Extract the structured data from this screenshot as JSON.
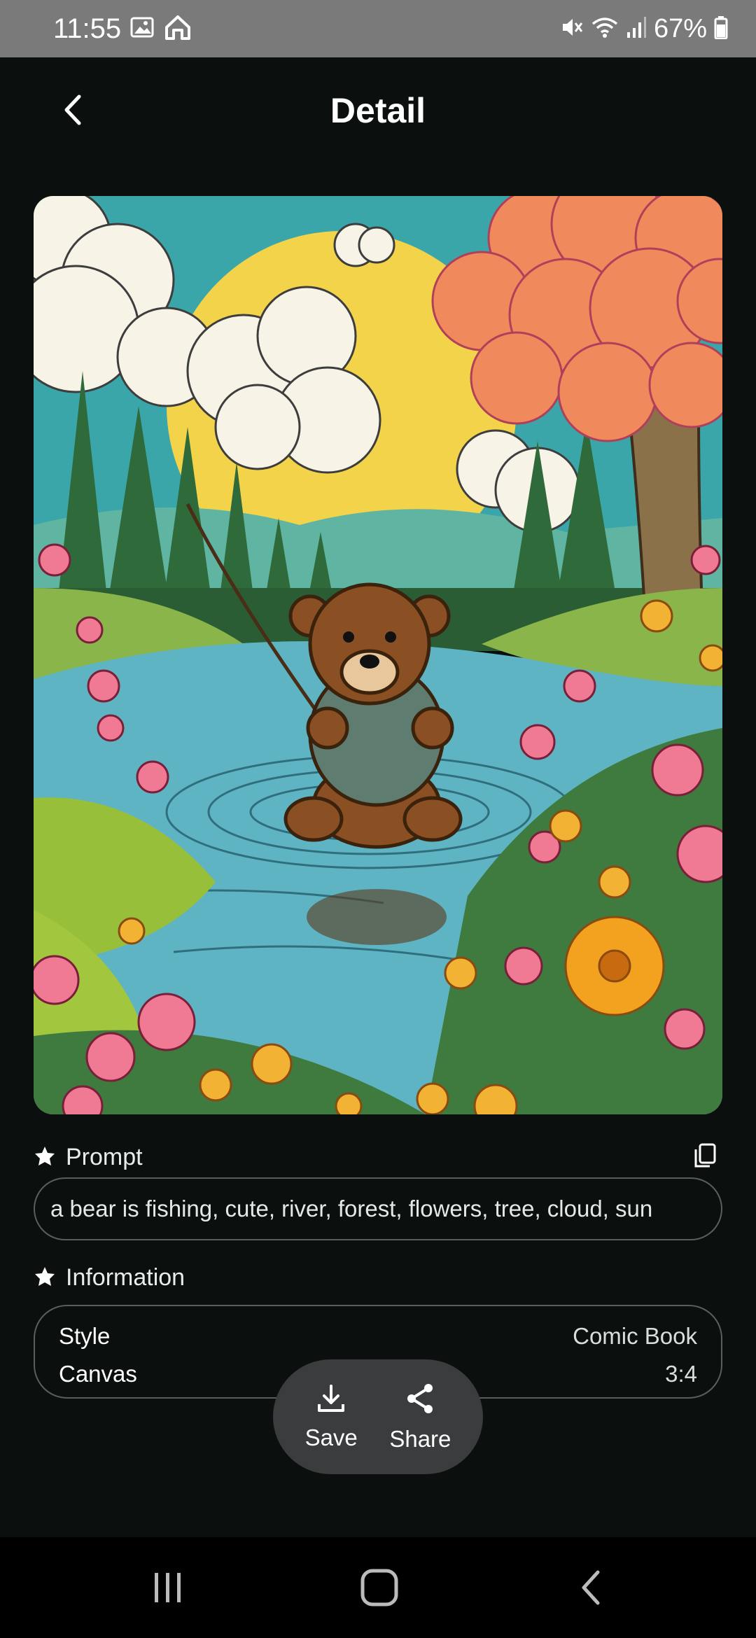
{
  "status_bar": {
    "time": "11:55",
    "battery": "67%",
    "icons": [
      "gallery-icon",
      "home-app-icon",
      "mute-icon",
      "wifi-icon",
      "signal-icon",
      "battery-icon"
    ]
  },
  "header": {
    "title": "Detail",
    "back_icon": "chevron-left-icon"
  },
  "artwork": {
    "subject": "bear-fishing-illustration"
  },
  "prompt_section": {
    "label": "Prompt",
    "text": "a bear is fishing, cute, river, forest, flowers, tree, cloud, sun",
    "icon": "star-icon",
    "copy_icon": "copy-icon"
  },
  "info_section": {
    "label": "Information",
    "icon": "star-icon",
    "rows": [
      {
        "key": "Style",
        "value": "Comic Book"
      },
      {
        "key": "Canvas",
        "value": "3:4"
      }
    ]
  },
  "actions": {
    "save_label": "Save",
    "share_label": "Share"
  },
  "colors": {
    "background": "#0b100f",
    "status_bar": "#7a7a7a",
    "pill": "#3a3c3d",
    "border": "#5a5f5e"
  }
}
